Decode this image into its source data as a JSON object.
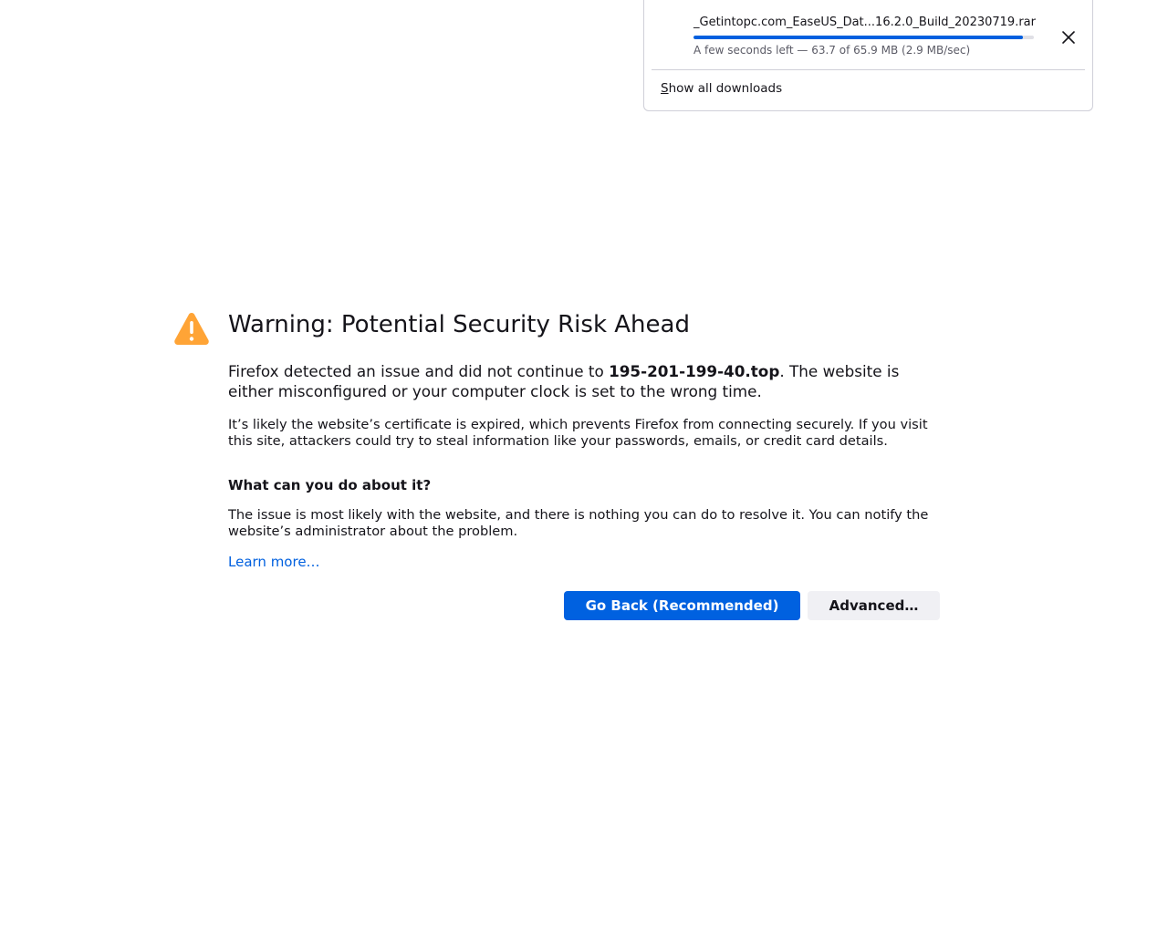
{
  "download_panel": {
    "filename": "_Getintopc.com_EaseUS_Dat...16.2.0_Build_20230719.rar",
    "progress_fraction": 0.967,
    "status": "A few seconds left — 63.7 of 65.9 MB (2.9 MB/sec)",
    "show_all_accesskey": "S",
    "show_all_rest": "how all downloads",
    "close_icon": "close-icon"
  },
  "error_page": {
    "icon": "warning-icon",
    "title": "Warning: Potential Security Risk Ahead",
    "intro_before": "Firefox detected an issue and did not continue to ",
    "intro_host": "195-201-199-40.top",
    "intro_after": ". The website is either misconfigured or your computer clock is set to the wrong time.",
    "detail": "It’s likely the website’s certificate is expired, which prevents Firefox from connecting securely. If you visit this site, attackers could try to steal information like your passwords, emails, or credit card details.",
    "subheading": "What can you do about it?",
    "advice": "The issue is most likely with the website, and there is nothing you can do to resolve it. You can notify the website’s administrator about the problem.",
    "learn_more": "Learn more…",
    "go_back_label": "Go Back (Recommended)",
    "advanced_label": "Advanced…"
  },
  "colors": {
    "accent": "#0061e0",
    "warning": "#ffa436",
    "progress": "#0060df"
  }
}
